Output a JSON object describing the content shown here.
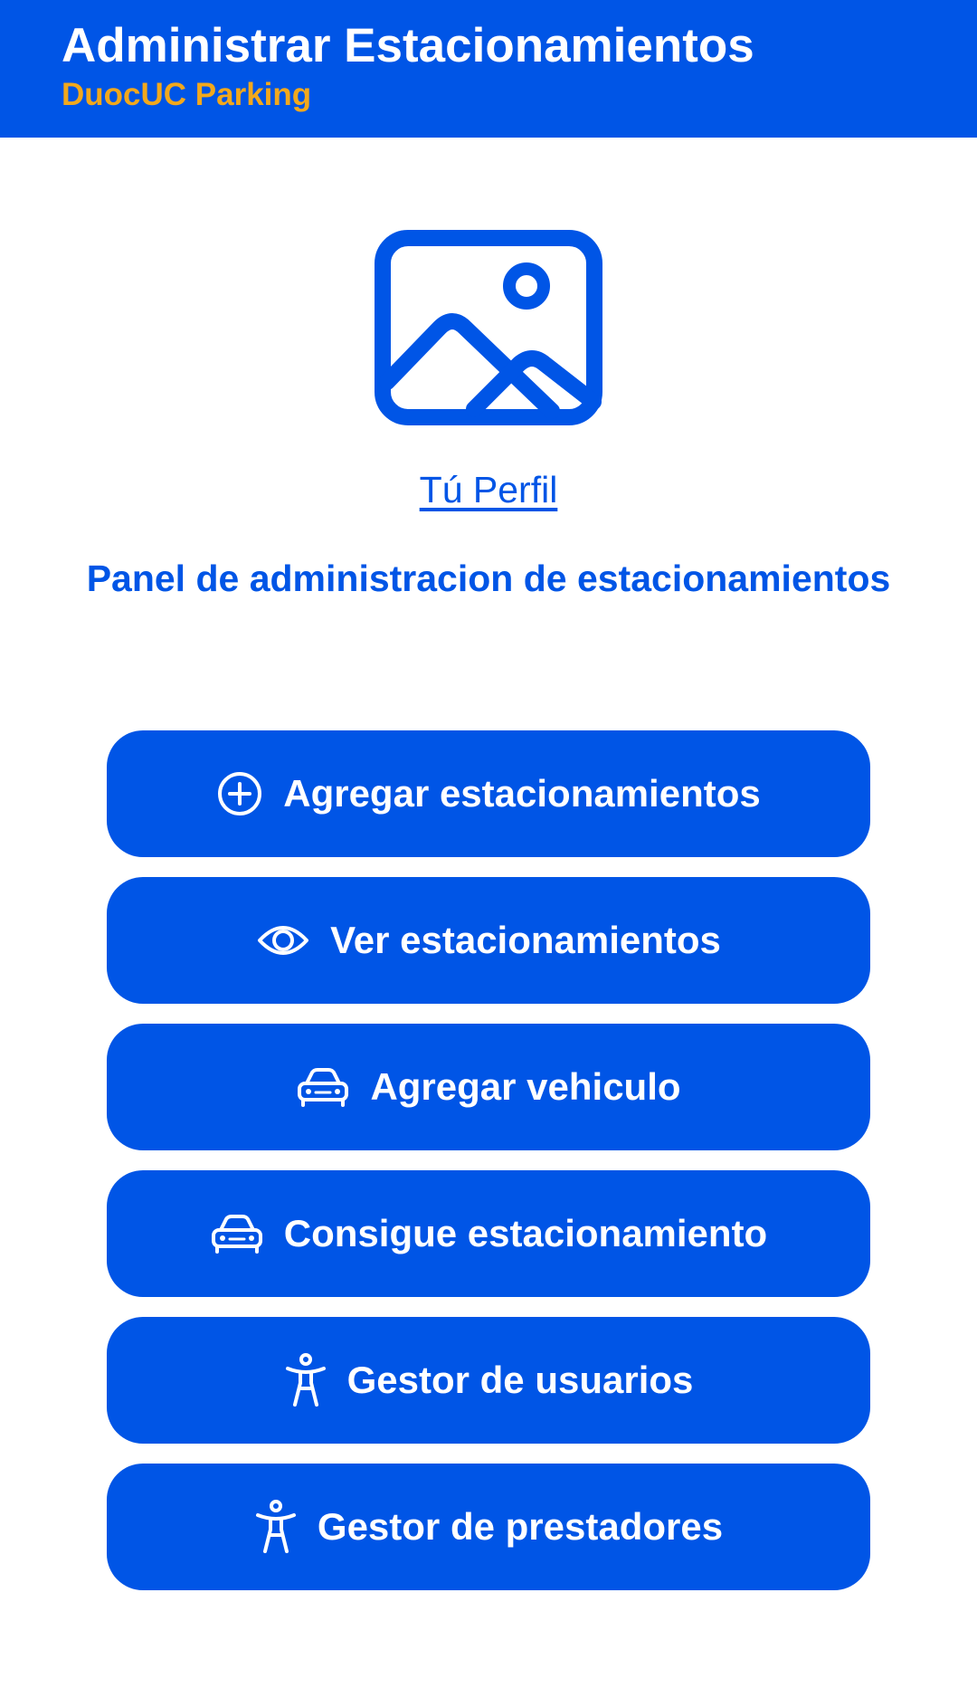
{
  "header": {
    "title": "Administrar Estacionamientos",
    "subtitle": "DuocUC Parking"
  },
  "profile": {
    "image_icon": "image-placeholder-icon",
    "link_label": "Tú Perfil"
  },
  "panel": {
    "title": "Panel de administracion de estacionamientos"
  },
  "menu": {
    "items": [
      {
        "label": "Agregar estacionamientos",
        "icon": "add-circle-icon"
      },
      {
        "label": "Ver estacionamientos",
        "icon": "eye-icon"
      },
      {
        "label": "Agregar vehiculo",
        "icon": "car-icon"
      },
      {
        "label": "Consigue estacionamiento",
        "icon": "car-icon"
      },
      {
        "label": "Gestor de usuarios",
        "icon": "accessibility-icon"
      },
      {
        "label": "Gestor de prestadores",
        "icon": "accessibility-icon"
      }
    ]
  },
  "colors": {
    "primary": "#0055e6",
    "accent": "#f2a81c",
    "background": "#ffffff"
  }
}
